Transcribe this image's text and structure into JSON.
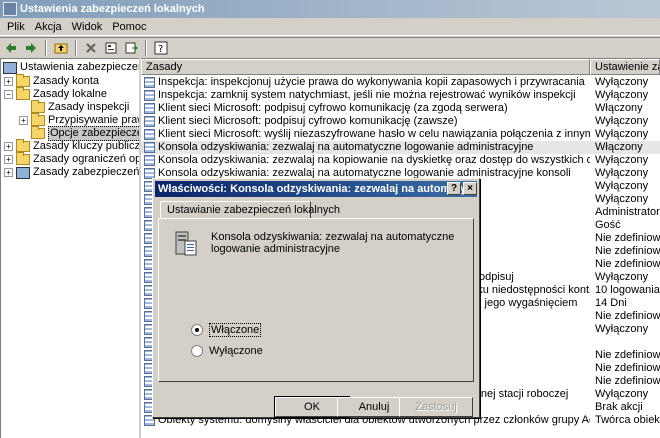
{
  "window": {
    "title": "Ustawienia zabezpieczeń lokalnych"
  },
  "menu": [
    "Plik",
    "Akcja",
    "Widok",
    "Pomoc"
  ],
  "tree": [
    {
      "label": "Ustawienia zabezpieczeń",
      "level": 0,
      "icon": "computer"
    },
    {
      "label": "Zasady konta",
      "level": 1,
      "icon": "folder"
    },
    {
      "label": "Zasady lokalne",
      "level": 1,
      "icon": "folder"
    },
    {
      "label": "Zasady inspekcji",
      "level": 2,
      "icon": "folder"
    },
    {
      "label": "Przypisywanie praw użytkownika",
      "level": 2,
      "icon": "folder"
    },
    {
      "label": "Opcje zabezpieczeń",
      "level": 2,
      "icon": "folder",
      "selected": true
    },
    {
      "label": "Zasady kluczy publicznych",
      "level": 1,
      "icon": "folder"
    },
    {
      "label": "Zasady ograniczeń oprogramowania",
      "level": 1,
      "icon": "folder"
    },
    {
      "label": "Zasady zabezpieczeń IP w komputerze lokalnym",
      "level": 1,
      "icon": "computer"
    }
  ],
  "list": {
    "headers": [
      "Zasady",
      "Ustawienie zabezpieczeń"
    ],
    "rows": [
      {
        "policy": "Inspekcja: inspekcjonuj użycie prawa do wykonywania kopii zapasowych i przywracania",
        "setting": "Wyłączony"
      },
      {
        "policy": "Inspekcja: zamknij system natychmiast, jeśli nie można rejestrować wyników inspekcji",
        "setting": "Wyłączony"
      },
      {
        "policy": "Klient sieci Microsoft: podpisuj cyfrowo komunikację (za zgodą serwera)",
        "setting": "Włączony"
      },
      {
        "policy": "Klient sieci Microsoft: podpisuj cyfrowo komunikację (zawsze)",
        "setting": "Wyłączony"
      },
      {
        "policy": "Klient sieci Microsoft: wyślij niezaszyfrowane hasło w celu nawiązania połączenia z innymi serwerami SMB",
        "setting": "Wyłączony"
      },
      {
        "policy": "Konsola odzyskiwania: zezwalaj na automatyczne logowanie administracyjne",
        "setting": "Włączony",
        "selected": true
      },
      {
        "policy": "Konsola odzyskiwania: zezwalaj na kopiowanie na dyskietkę oraz dostęp do wszystkich dysków i folderów",
        "setting": "Wyłączony"
      },
      {
        "policy": "Konsola odzyskiwania: zezwalaj na automatyczne logowanie administracyjne konsoli",
        "setting": "Wyłączony"
      },
      {
        "policy": "",
        "setting": "Wyłączony"
      },
      {
        "policy": "",
        "setting": "Wyłączony"
      },
      {
        "policy": "",
        "setting": "Administrator"
      },
      {
        "policy": "",
        "setting": "Gość"
      },
      {
        "policy": "",
        "setting": "Nie zdefiniowane"
      },
      {
        "policy": "",
        "setting": "Nie zdefiniowane"
      },
      {
        "policy": "",
        "setting": "Nie zdefiniowane"
      },
      {
        "policy": "szyfruj lub podpisuj cyfrowo dane bezpiecznego kanału: szyfruj i podpisuj",
        "setting": "Wyłączony"
      },
      {
        "policy": "ulinku liczba poprzednich zalogowań do zbuforowania (w przypadku niedostępności kontrolera domeny)",
        "setting": "10 logowania"
      },
      {
        "policy": "logowanie interakcyjne: monituj użytkownika o zmianę hasła przed jego wygaśnięciem",
        "setting": "14 Dni"
      },
      {
        "policy": "",
        "setting": "Nie zdefiniowane"
      },
      {
        "policy": "",
        "setting": "Wyłączony"
      },
      {
        "policy": "owac",
        "setting": ""
      },
      {
        "policy": "",
        "setting": "Nie zdefiniowane"
      },
      {
        "policy": "",
        "setting": "Nie zdefiniowane"
      },
      {
        "policy": "",
        "setting": "Nie zdefiniowane"
      },
      {
        "policy": "logowanie interakcyjne: zachowanie przy usuwaniu karty inteligentnej stacji roboczej",
        "setting": "Wyłączony"
      },
      {
        "policy": "",
        "setting": "Brak akcji"
      },
      {
        "policy": "Obiekty systemu: domyślny właściciel dla obiektów utworzonych przez członków grupy Administratorzy",
        "setting": "Twórca obiektu"
      }
    ]
  },
  "dialog": {
    "title": "Właściwości: Konsola odzyskiwania: zezwalaj na automatyczn...",
    "tab": "Ustawianie zabezpieczeń lokalnych",
    "description": "Konsola odzyskiwania: zezwalaj na automatyczne logowanie administracyjne",
    "radios": [
      {
        "label": "Włączone",
        "checked": true
      },
      {
        "label": "Wyłączone",
        "checked": false
      }
    ],
    "buttons": {
      "ok": "OK",
      "cancel": "Anuluj",
      "apply": "Zastosuj"
    }
  }
}
